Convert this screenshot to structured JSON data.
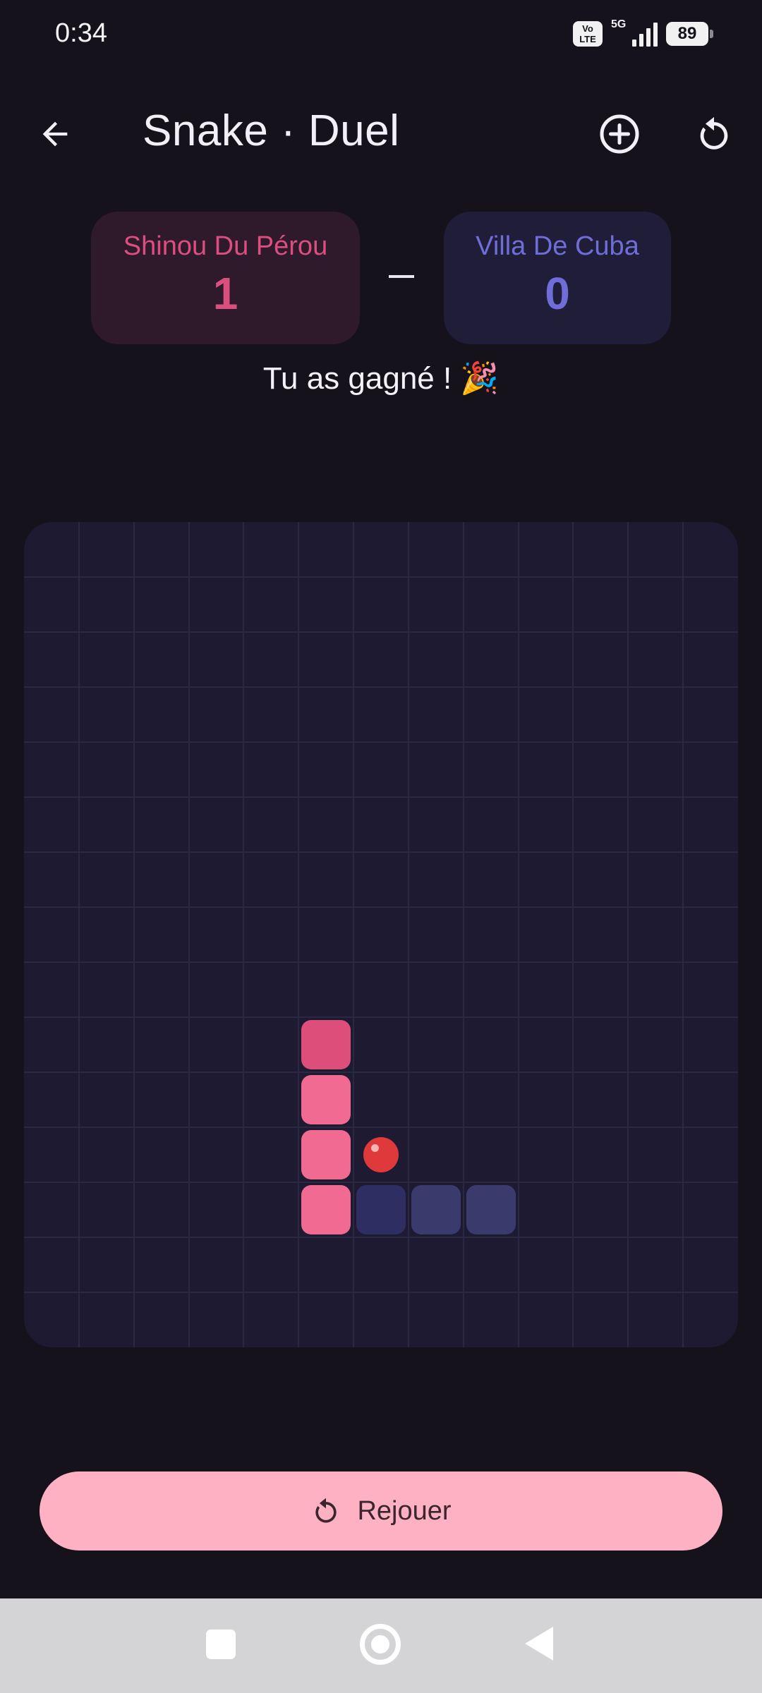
{
  "status_bar": {
    "time": "0:34",
    "volte": "Vo LTE",
    "network": "5G",
    "battery": "89"
  },
  "appbar": {
    "title": "Snake · Duel",
    "icons": [
      "arrow-left-icon",
      "add-circle-icon",
      "refresh-icon"
    ]
  },
  "scoreboard": {
    "player1": {
      "name": "Shinou Du Pérou",
      "score": "1",
      "color": "#da4f7d"
    },
    "separator": "–",
    "player2": {
      "name": "Villa De Cuba",
      "score": "0",
      "color": "#6f6ed8"
    }
  },
  "result_message": "Tu as gagné ! 🎉",
  "board": {
    "columns": 13,
    "rows": 15,
    "snake_player1": [
      [
        5,
        9
      ],
      [
        5,
        10
      ],
      [
        5,
        11
      ],
      [
        5,
        12
      ]
    ],
    "snake_player2": [
      [
        6,
        12
      ],
      [
        7,
        12
      ],
      [
        8,
        12
      ]
    ],
    "food": [
      6,
      11
    ]
  },
  "replay_button": {
    "label": "Rejouer"
  }
}
